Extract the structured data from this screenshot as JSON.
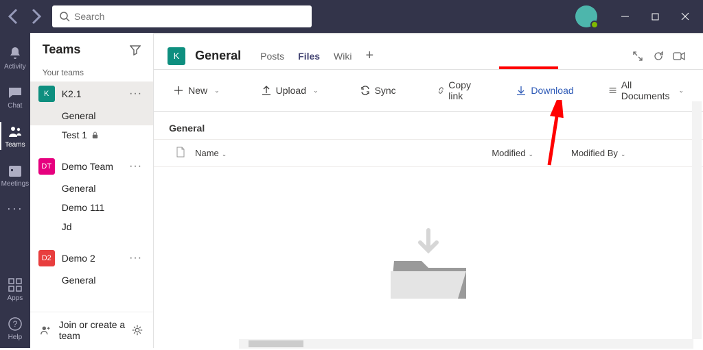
{
  "titlebar": {
    "search_placeholder": "Search"
  },
  "apprail": {
    "activity": "Activity",
    "chat": "Chat",
    "teams": "Teams",
    "meetings": "Meetings",
    "apps": "Apps",
    "help": "Help"
  },
  "sidebar": {
    "title": "Teams",
    "your_teams_label": "Your teams",
    "teams": [
      {
        "badge": "K",
        "badge_bg": "#0e8f7f",
        "name": "K2.1",
        "channels": [
          "General",
          "Test 1"
        ],
        "locked_index": 1
      },
      {
        "badge": "DT",
        "badge_bg": "#e6007e",
        "name": "Demo Team",
        "channels": [
          "General",
          "Demo 111",
          "Jd"
        ]
      },
      {
        "badge": "D2",
        "badge_bg": "#e83e3e",
        "name": "Demo 2",
        "channels": [
          "General"
        ]
      }
    ],
    "footer": "Join or create a team"
  },
  "channel": {
    "badge": "K",
    "title": "General",
    "tabs": [
      "Posts",
      "Files",
      "Wiki"
    ],
    "active_tab": 1
  },
  "toolbar": {
    "new": "New",
    "upload": "Upload",
    "sync": "Sync",
    "copylink": "Copy link",
    "download": "Download",
    "alldocs": "All Documents"
  },
  "doclib": {
    "title": "General",
    "cols": {
      "name": "Name",
      "modified": "Modified",
      "modifiedby": "Modified By"
    }
  }
}
